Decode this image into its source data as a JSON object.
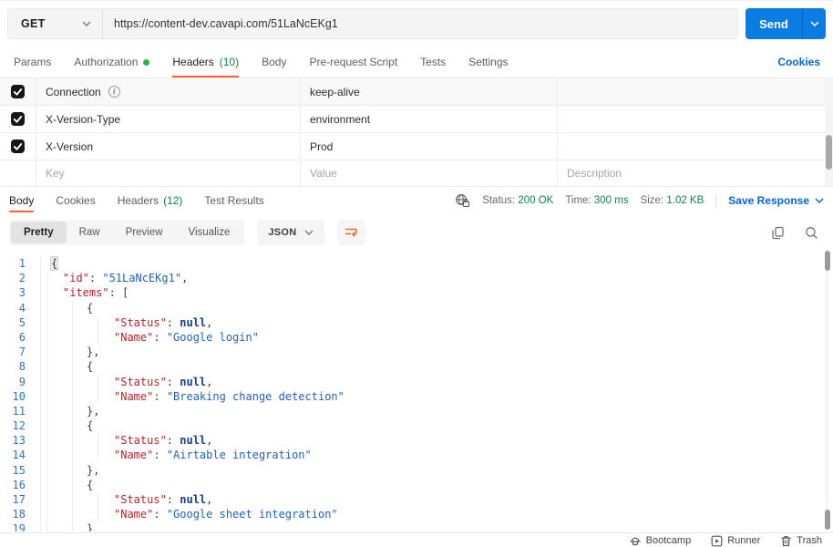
{
  "request": {
    "method": "GET",
    "url": "https://content-dev.cavapi.com/51LaNcEKg1",
    "send_label": "Send",
    "tabs": {
      "params": "Params",
      "authorization": "Authorization",
      "headers": "Headers",
      "headers_count": "(10)",
      "body": "Body",
      "prerequest": "Pre-request Script",
      "tests": "Tests",
      "settings": "Settings"
    },
    "cookies_link": "Cookies"
  },
  "headers_table": {
    "rows": [
      {
        "key": "Connection",
        "value": "keep-alive"
      },
      {
        "key": "X-Version-Type",
        "value": "environment"
      },
      {
        "key": "X-Version",
        "value": "Prod"
      }
    ],
    "placeholder": {
      "key": "Key",
      "value": "Value",
      "description": "Description"
    }
  },
  "response": {
    "tabs": {
      "body": "Body",
      "cookies": "Cookies",
      "headers": "Headers",
      "headers_count": "(12)",
      "tests": "Test Results"
    },
    "meta": {
      "status_label": "Status:",
      "status_value": "200 OK",
      "time_label": "Time:",
      "time_value": "300 ms",
      "size_label": "Size:",
      "size_value": "1.02 KB"
    },
    "save_response": "Save Response",
    "views": {
      "pretty": "Pretty",
      "raw": "Raw",
      "preview": "Preview",
      "visualize": "Visualize"
    },
    "format": "JSON",
    "code_lines": [
      {
        "n": "1",
        "lvl": 0,
        "tokens": [
          [
            "{",
            "ph"
          ]
        ]
      },
      {
        "n": "2",
        "lvl": 1,
        "tokens": [
          [
            "\"id\"",
            "k"
          ],
          [
            ": ",
            "p"
          ],
          [
            "\"51LaNcEKg1\"",
            "s"
          ],
          [
            ",",
            "p"
          ]
        ]
      },
      {
        "n": "3",
        "lvl": 1,
        "tokens": [
          [
            "\"items\"",
            "k"
          ],
          [
            ": [",
            "p"
          ]
        ]
      },
      {
        "n": "4",
        "lvl": 2,
        "tokens": [
          [
            "{",
            "p"
          ]
        ]
      },
      {
        "n": "5",
        "lvl": 3,
        "tokens": [
          [
            "\"Status\"",
            "k"
          ],
          [
            ": ",
            "p"
          ],
          [
            "null",
            "n"
          ],
          [
            ",",
            "p"
          ]
        ]
      },
      {
        "n": "6",
        "lvl": 3,
        "tokens": [
          [
            "\"Name\"",
            "k"
          ],
          [
            ": ",
            "p"
          ],
          [
            "\"Google login\"",
            "s"
          ]
        ]
      },
      {
        "n": "7",
        "lvl": 2,
        "tokens": [
          [
            "},",
            "p"
          ]
        ]
      },
      {
        "n": "8",
        "lvl": 2,
        "tokens": [
          [
            "{",
            "p"
          ]
        ]
      },
      {
        "n": "9",
        "lvl": 3,
        "tokens": [
          [
            "\"Status\"",
            "k"
          ],
          [
            ": ",
            "p"
          ],
          [
            "null",
            "n"
          ],
          [
            ",",
            "p"
          ]
        ]
      },
      {
        "n": "10",
        "lvl": 3,
        "tokens": [
          [
            "\"Name\"",
            "k"
          ],
          [
            ": ",
            "p"
          ],
          [
            "\"Breaking change detection\"",
            "s"
          ]
        ]
      },
      {
        "n": "11",
        "lvl": 2,
        "tokens": [
          [
            "},",
            "p"
          ]
        ]
      },
      {
        "n": "12",
        "lvl": 2,
        "tokens": [
          [
            "{",
            "p"
          ]
        ]
      },
      {
        "n": "13",
        "lvl": 3,
        "tokens": [
          [
            "\"Status\"",
            "k"
          ],
          [
            ": ",
            "p"
          ],
          [
            "null",
            "n"
          ],
          [
            ",",
            "p"
          ]
        ]
      },
      {
        "n": "14",
        "lvl": 3,
        "tokens": [
          [
            "\"Name\"",
            "k"
          ],
          [
            ": ",
            "p"
          ],
          [
            "\"Airtable integration\"",
            "s"
          ]
        ]
      },
      {
        "n": "15",
        "lvl": 2,
        "tokens": [
          [
            "},",
            "p"
          ]
        ]
      },
      {
        "n": "16",
        "lvl": 2,
        "tokens": [
          [
            "{",
            "p"
          ]
        ]
      },
      {
        "n": "17",
        "lvl": 3,
        "tokens": [
          [
            "\"Status\"",
            "k"
          ],
          [
            ": ",
            "p"
          ],
          [
            "null",
            "n"
          ],
          [
            ",",
            "p"
          ]
        ]
      },
      {
        "n": "18",
        "lvl": 3,
        "tokens": [
          [
            "\"Name\"",
            "k"
          ],
          [
            ": ",
            "p"
          ],
          [
            "\"Google sheet integration\"",
            "s"
          ]
        ]
      },
      {
        "n": "19",
        "lvl": 2,
        "tokens": [
          [
            "}",
            "p"
          ]
        ]
      }
    ]
  },
  "footer": {
    "bootcamp": "Bootcamp",
    "runner": "Runner",
    "trash": "Trash"
  },
  "colors": {
    "accent_orange": "#f0642f",
    "send_blue": "#0b7ce2",
    "link_blue": "#0265d2",
    "success_green": "#0e8345",
    "code_key_red": "#b5232a",
    "code_string_blue": "#1f62ba",
    "code_null_navy": "#173e8f",
    "line_number_blue": "#3573b9"
  }
}
